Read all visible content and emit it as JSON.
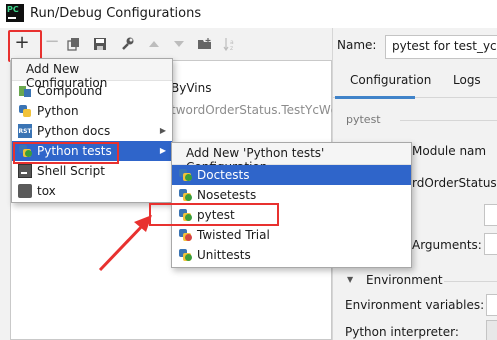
{
  "window": {
    "title": "Run/Debug Configurations",
    "logo_text": "PC"
  },
  "toolbar": {
    "items": [
      {
        "name": "add",
        "glyph": "+"
      },
      {
        "name": "remove",
        "glyph": "−"
      },
      {
        "name": "copy",
        "glyph": "⧉"
      },
      {
        "name": "save",
        "glyph": "🖫"
      },
      {
        "name": "edit-defaults",
        "glyph": "🔧"
      },
      {
        "name": "move-up",
        "glyph": "▲"
      },
      {
        "name": "move-down",
        "glyph": "▼"
      },
      {
        "name": "folder",
        "glyph": "📁"
      },
      {
        "name": "sort",
        "glyph": "↓a"
      }
    ]
  },
  "tree": {
    "row1_suffix": "ByVins",
    "row2_suffix": "twordOrderStatus.TestYcWc"
  },
  "name_field": {
    "label": "Name:",
    "value": "pytest for test_ycw"
  },
  "tabs": [
    {
      "label": "Configuration"
    },
    {
      "label": "Logs"
    }
  ],
  "config": {
    "section": "pytest",
    "module_label": "Module nam",
    "target_value": "rdOrderStatus.T",
    "arguments_label": "Arguments:",
    "environment_label": "Environment",
    "env_vars_label": "Environment variables:",
    "interpreter_label": "Python interpreter:"
  },
  "popup_add": {
    "header": "Add New Configuration",
    "items": [
      {
        "label": "Compound",
        "icon": "compound-icon",
        "submenu": false
      },
      {
        "label": "Python",
        "icon": "python-icon",
        "submenu": false
      },
      {
        "label": "Python docs",
        "icon": "rst-icon",
        "submenu": true
      },
      {
        "label": "Python tests",
        "icon": "python-tests-icon",
        "submenu": true,
        "selected": true
      },
      {
        "label": "Shell Script",
        "icon": "shell-script-icon",
        "submenu": false
      },
      {
        "label": "tox",
        "icon": "tox-icon",
        "submenu": false
      }
    ]
  },
  "popup_tests": {
    "header": "Add New 'Python tests' Configuration",
    "items": [
      {
        "label": "Doctests",
        "selected": true
      },
      {
        "label": "Nosetests"
      },
      {
        "label": "pytest"
      },
      {
        "label": "Twisted Trial"
      },
      {
        "label": "Unittests"
      }
    ]
  },
  "colors": {
    "selection": "#2f65ca",
    "annotation": "#e8312f",
    "tab_underline": "#4083c9"
  }
}
